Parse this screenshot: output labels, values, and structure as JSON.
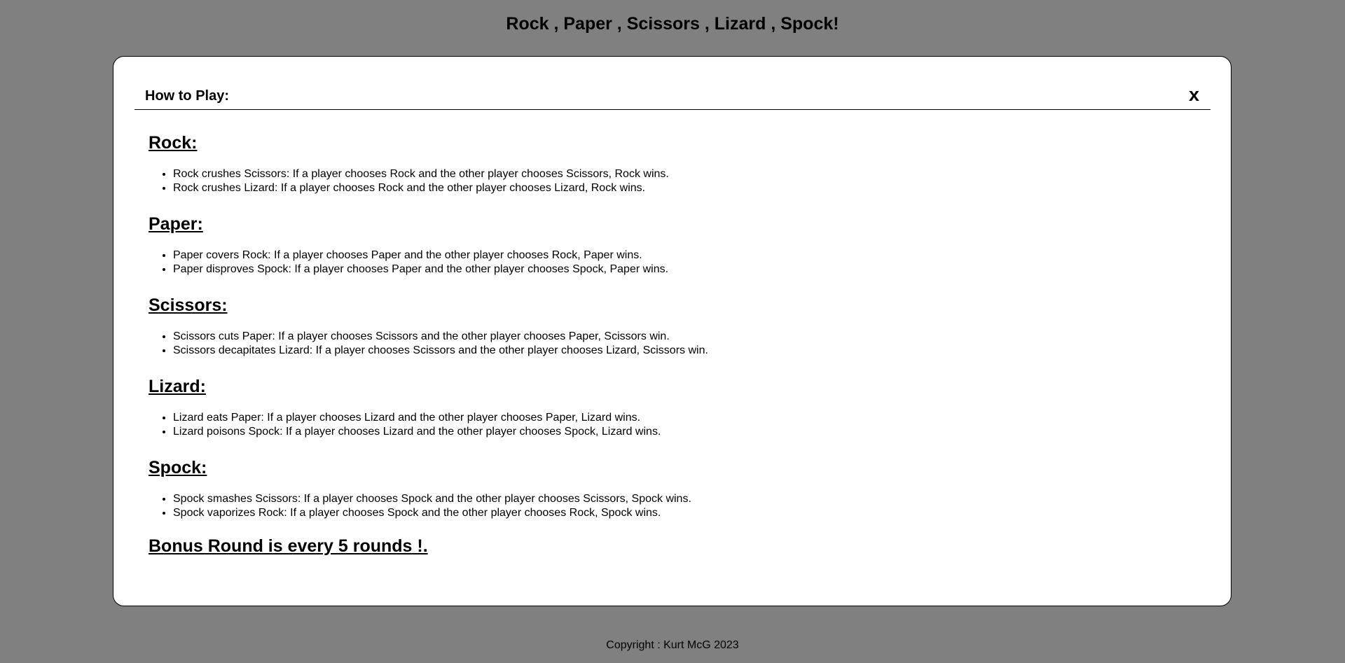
{
  "header": {
    "title": "Rock , Paper , Scissors , Lizard , Spock!"
  },
  "modal": {
    "title": "How to Play:",
    "close_label": "x",
    "sections": [
      {
        "heading": "Rock:",
        "rules": [
          "Rock crushes Scissors: If a player chooses Rock and the other player chooses Scissors, Rock wins.",
          "Rock crushes Lizard: If a player chooses Rock and the other player chooses Lizard, Rock wins."
        ]
      },
      {
        "heading": "Paper:",
        "rules": [
          "Paper covers Rock: If a player chooses Paper and the other player chooses Rock, Paper wins.",
          "Paper disproves Spock: If a player chooses Paper and the other player chooses Spock, Paper wins."
        ]
      },
      {
        "heading": "Scissors:",
        "rules": [
          "Scissors cuts Paper: If a player chooses Scissors and the other player chooses Paper, Scissors win.",
          "Scissors decapitates Lizard: If a player chooses Scissors and the other player chooses Lizard, Scissors win."
        ]
      },
      {
        "heading": "Lizard:",
        "rules": [
          "Lizard eats Paper: If a player chooses Lizard and the other player chooses Paper, Lizard wins.",
          "Lizard poisons Spock: If a player chooses Lizard and the other player chooses Spock, Lizard wins."
        ]
      },
      {
        "heading": "Spock:",
        "rules": [
          "Spock smashes Scissors: If a player chooses Spock and the other player chooses Scissors, Spock wins.",
          "Spock vaporizes Rock: If a player chooses Spock and the other player chooses Rock, Spock wins."
        ]
      }
    ],
    "bonus": "Bonus Round is every 5 rounds !."
  },
  "footer": {
    "copyright": "Copyright : Kurt McG 2023"
  }
}
